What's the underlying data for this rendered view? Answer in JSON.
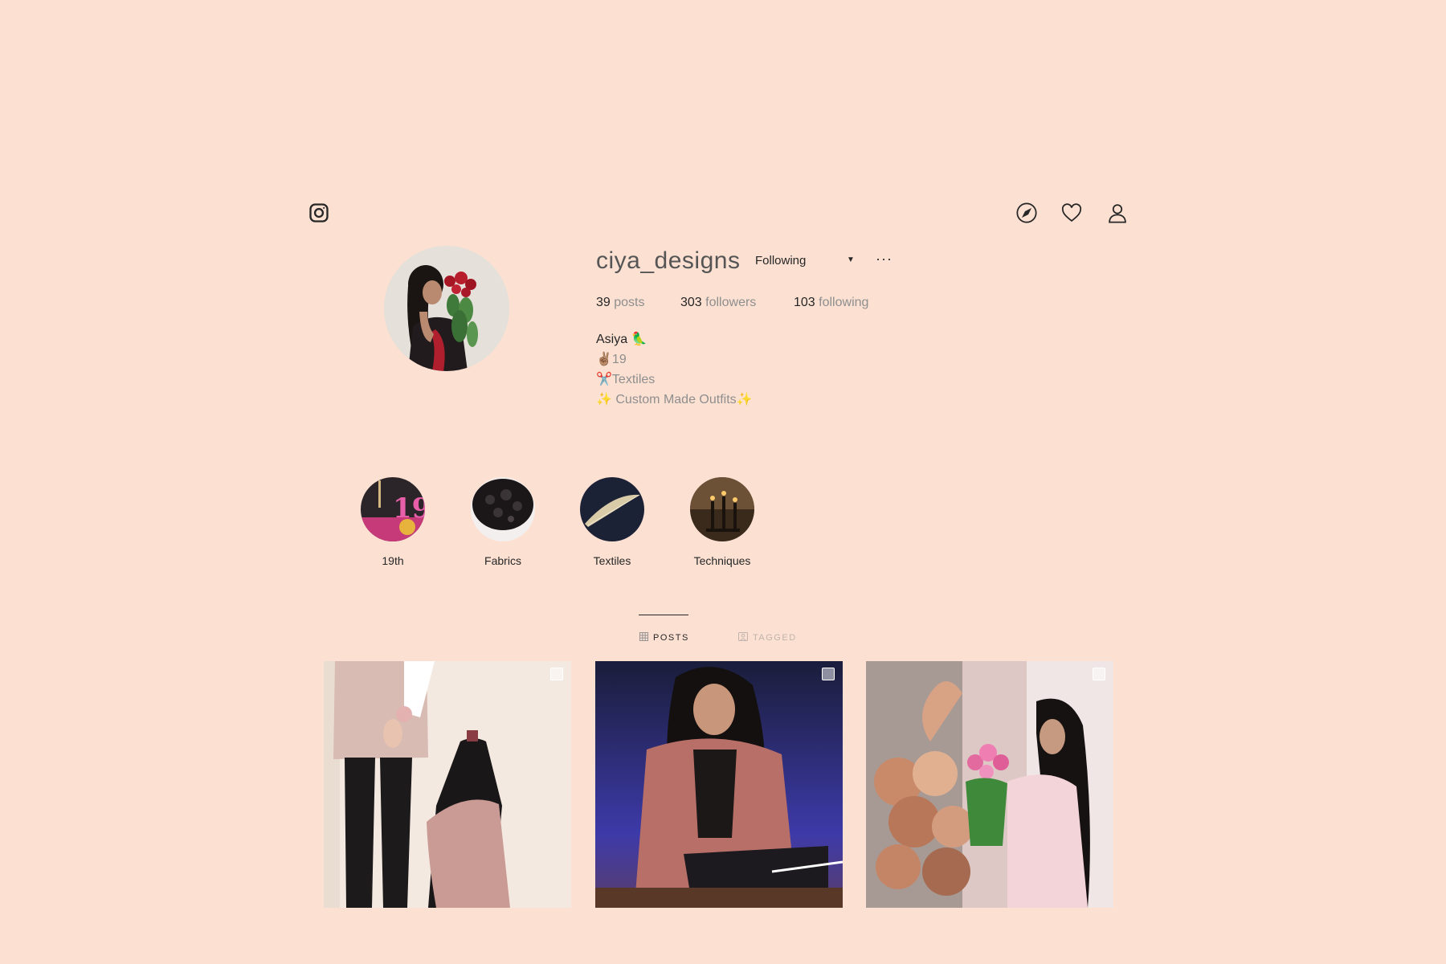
{
  "header": {
    "logo_icon": "instagram-icon",
    "nav_icons": [
      "compass-icon",
      "heart-icon",
      "user-icon"
    ]
  },
  "profile": {
    "username": "ciya_designs",
    "follow_button": "Following",
    "more_label": "···",
    "stats": {
      "posts_count": "39",
      "posts_label": "posts",
      "followers_count": "303",
      "followers_label": "followers",
      "following_count": "103",
      "following_label": "following"
    },
    "bio": {
      "name": "Asiya 🦜",
      "line1": "✌🏽19",
      "line2": "✂️Textiles",
      "line3": "✨ Custom Made Outfits✨"
    }
  },
  "highlights": [
    {
      "label": "19th"
    },
    {
      "label": "Fabrics"
    },
    {
      "label": "Textiles"
    },
    {
      "label": "Techniques"
    }
  ],
  "tabs": {
    "posts_label": "POSTS",
    "tagged_label": "TAGGED"
  },
  "colors": {
    "background": "#fce1d3",
    "text": "#262626",
    "muted": "#8e8e8e"
  }
}
